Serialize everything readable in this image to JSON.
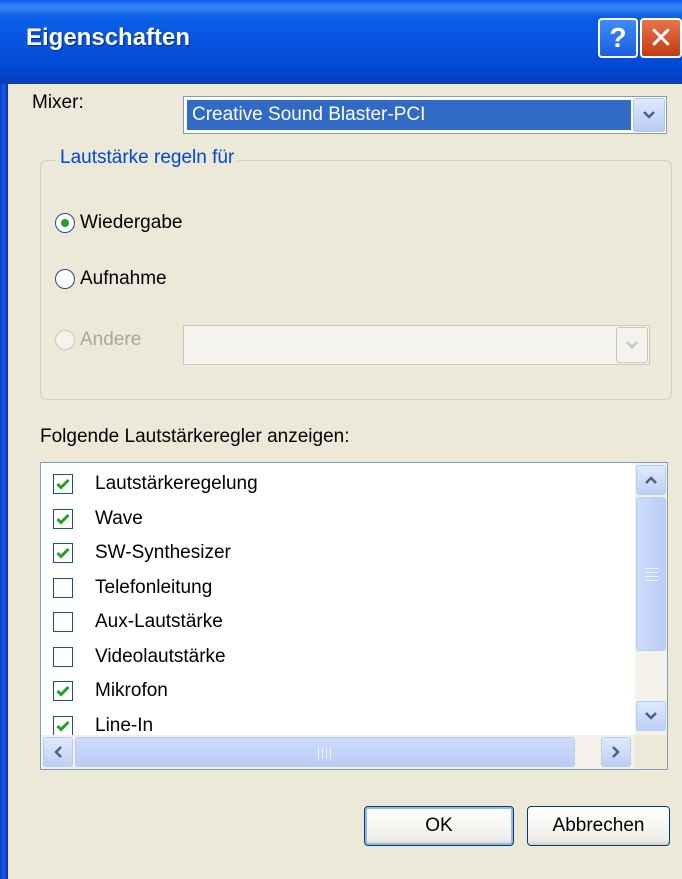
{
  "window": {
    "title": "Eigenschaften",
    "help_label": "?",
    "close_label": "✕"
  },
  "mixer": {
    "label": "Mixer:",
    "value": "Creative Sound Blaster-PCI"
  },
  "volume_group": {
    "title": "Lautstärke regeln für",
    "options": [
      {
        "label": "Wiedergabe",
        "checked": true,
        "enabled": true
      },
      {
        "label": "Aufnahme",
        "checked": false,
        "enabled": true
      },
      {
        "label": "Andere",
        "checked": false,
        "enabled": false
      }
    ]
  },
  "controls_list": {
    "label": "Folgende Lautstärkeregler anzeigen:",
    "items": [
      {
        "label": "Lautstärkeregelung",
        "checked": true
      },
      {
        "label": "Wave",
        "checked": true
      },
      {
        "label": "SW-Synthesizer",
        "checked": true
      },
      {
        "label": "Telefonleitung",
        "checked": false
      },
      {
        "label": "Aux-Lautstärke",
        "checked": false
      },
      {
        "label": "Videolautstärke",
        "checked": false
      },
      {
        "label": "Mikrofon",
        "checked": true
      },
      {
        "label": "Line-In",
        "checked": true
      }
    ]
  },
  "buttons": {
    "ok": "OK",
    "cancel": "Abbrechen"
  },
  "colors": {
    "titlebar": "#0553e0",
    "selection": "#316ac5",
    "check": "#21a121",
    "group_title": "#0046d5"
  }
}
